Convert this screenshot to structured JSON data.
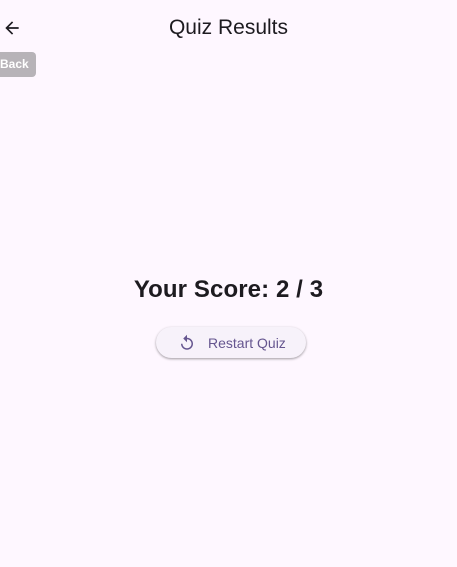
{
  "app_bar": {
    "title": "Quiz Results",
    "back_icon": "arrow-back-icon"
  },
  "tooltip": {
    "text": "Back"
  },
  "result": {
    "score_text": "Your Score: 2 / 3"
  },
  "restart_button": {
    "label": "Restart Quiz",
    "icon": "restart-icon"
  },
  "colors": {
    "background": "#fef7ff",
    "primary": "#65558f",
    "text": "#1d1b20",
    "tooltip_background": "#b7b3b8",
    "button_surface": "#f7f2fa"
  }
}
